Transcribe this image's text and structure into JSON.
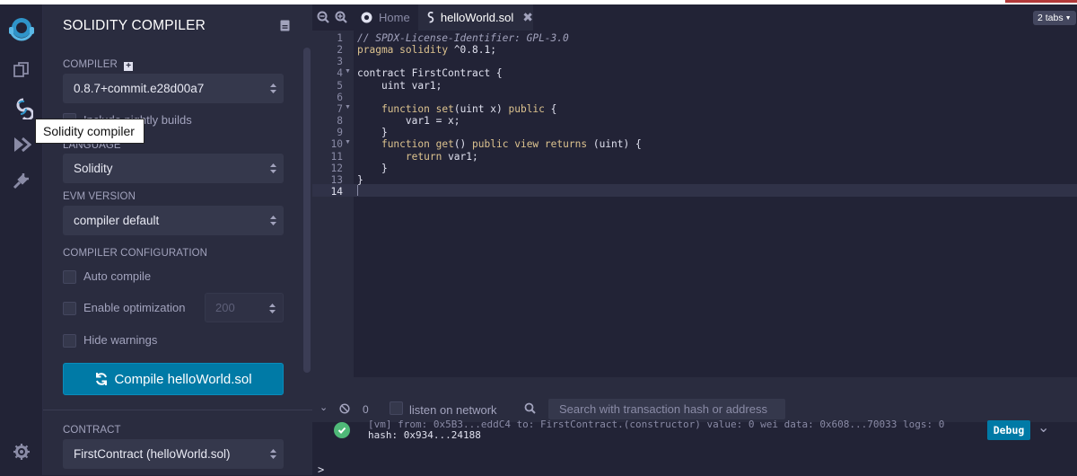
{
  "sidebar_tooltip": "Solidity compiler",
  "panel": {
    "title": "SOLIDITY COMPILER",
    "compiler_label": "COMPILER",
    "compiler_value": "0.8.7+commit.e28d00a7",
    "nightly_label": "Include nightly builds",
    "language_label": "LANGUAGE",
    "language_value": "Solidity",
    "evm_label": "EVM VERSION",
    "evm_value": "compiler default",
    "config_label": "COMPILER CONFIGURATION",
    "auto_compile": "Auto compile",
    "enable_optimization": "Enable optimization",
    "optimization_runs": "200",
    "hide_warnings": "Hide warnings",
    "compile_button": "Compile helloWorld.sol",
    "contract_label": "CONTRACT",
    "contract_value": "FirstContract (helloWorld.sol)"
  },
  "tabs": {
    "home": "Home",
    "active": "helloWorld.sol",
    "count": "2 tabs"
  },
  "editor": {
    "line_numbers": [
      "1",
      "2",
      "3",
      "4",
      "5",
      "6",
      "7",
      "8",
      "9",
      "10",
      "11",
      "12",
      "13",
      "14"
    ]
  },
  "terminal": {
    "count": "0",
    "listen_label": "listen on network",
    "search_placeholder": "Search with transaction hash or address",
    "log_line1": "[vm] from: 0x5B3...eddC4 to: FirstContract.(constructor) value: 0 wei data: 0x608...70033 logs: 0",
    "log_line2": "hash: 0x934...24188",
    "debug_button": "Debug",
    "prompt": ">"
  },
  "colors": {
    "accent": "#007aa6",
    "success": "#4fb978",
    "panel_bg": "#2a2c3f",
    "app_bg": "#222336"
  },
  "icons": [
    "remix-logo-icon",
    "file-explorer-icon",
    "solidity-compiler-icon",
    "deploy-run-icon",
    "plugin-manager-icon",
    "settings-icon"
  ]
}
